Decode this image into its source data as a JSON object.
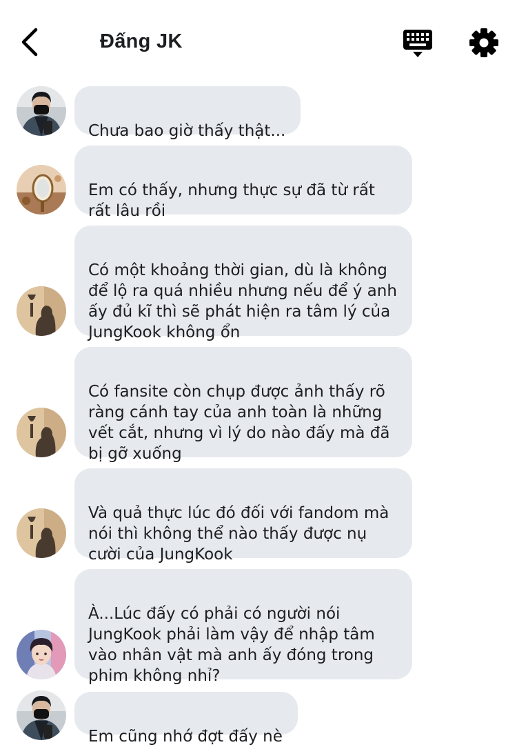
{
  "header": {
    "title": "Đấng JK",
    "back_icon": "chevron-left-icon",
    "keyboard_icon": "keyboard-icon",
    "settings_icon": "gear-icon"
  },
  "colors": {
    "bubble_bg": "#e6e9ed",
    "text": "#1c1e21",
    "icon": "#000000"
  },
  "messages": [
    {
      "avatar": "masked-boy-avatar",
      "text": "Chưa bao giờ thấy thật..."
    },
    {
      "avatar": "mirror-avatar",
      "text": "Em có thấy, nhưng thực sự đã từ rất\nrất lâu rồi"
    },
    {
      "avatar": "shadow-glass-avatar",
      "text": "Có một khoảng thời gian, dù là không\nđể lộ ra quá nhiều nhưng nếu để ý anh\nấy đủ kĩ thì sẽ phát hiện ra tâm lý của\nJungKook không ổn"
    },
    {
      "avatar": "shadow-glass-avatar",
      "text": "Có fansite còn chụp được ảnh thấy rõ\nràng cánh tay của anh toàn là những\nvết cắt, nhưng vì lý do nào đấy mà đã\nbị gỡ xuống"
    },
    {
      "avatar": "shadow-glass-avatar",
      "text": "Và quả thực lúc đó đối với fandom mà\nnói thì không thể nào thấy được nụ\ncười của JungKook"
    },
    {
      "avatar": "portrait-avatar",
      "text": "À...Lúc đấy có phải có người nói\nJungKook phải làm vậy để nhập tâm\nvào nhân vật mà anh ấy đóng trong\nphim không nhỉ?"
    },
    {
      "avatar": "masked-boy-avatar",
      "text": "Em cũng nhớ đợt đấy nè"
    }
  ]
}
